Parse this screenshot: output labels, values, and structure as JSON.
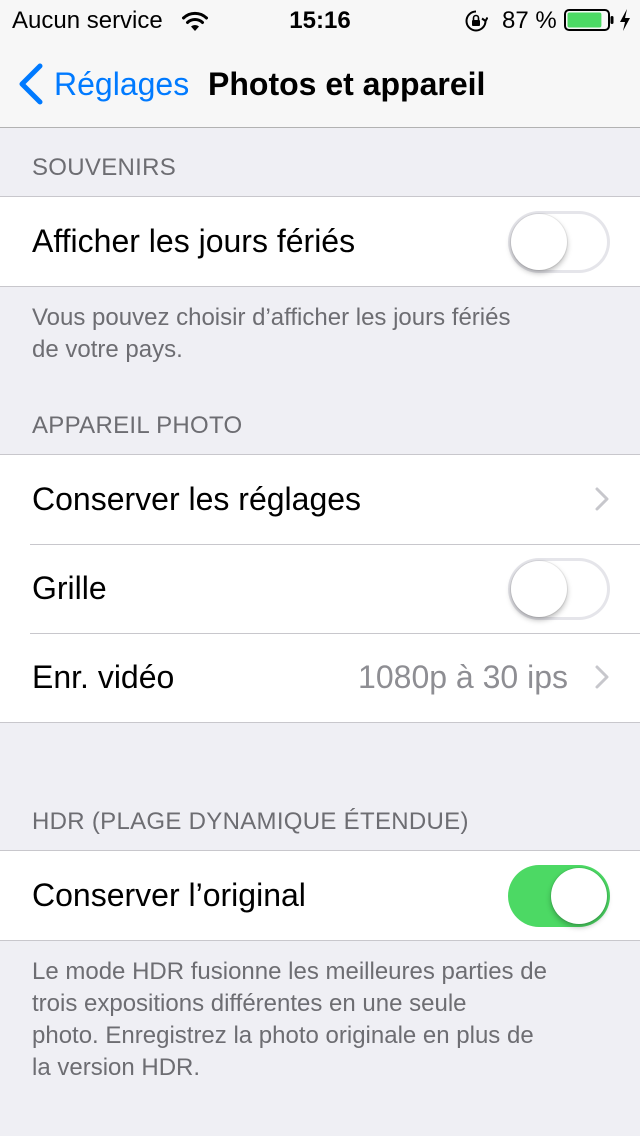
{
  "status_bar": {
    "carrier": "Aucun service",
    "time": "15:16",
    "battery_percent": "87 %",
    "battery_level": 0.87,
    "battery_color": "#4cd964"
  },
  "nav": {
    "back_label": "Réglages",
    "title": "Photos et appareil",
    "accent_color": "#007aff"
  },
  "sections": {
    "souvenirs": {
      "header": "SOUVENIRS",
      "rows": [
        {
          "label": "Afficher les jours fériés",
          "toggle": false
        }
      ],
      "footer": [
        "Vous pouvez choisir d’afficher les jours fériés",
        "de votre pays."
      ]
    },
    "camera": {
      "header": "APPAREIL PHOTO",
      "rows": [
        {
          "label": "Conserver les réglages",
          "chevron": true
        },
        {
          "label": "Grille",
          "toggle": false
        },
        {
          "label": "Enr. vidéo",
          "detail": "1080p à 30 ips",
          "chevron": true
        }
      ]
    },
    "hdr": {
      "header": "HDR (PLAGE DYNAMIQUE ÉTENDUE)",
      "rows": [
        {
          "label": "Conserver l’original",
          "toggle": true
        }
      ],
      "footer": [
        "Le mode HDR fusionne les meilleures parties de",
        "trois expositions différentes en une seule",
        "photo. Enregistrez la photo originale en plus de",
        "la version HDR."
      ]
    }
  },
  "icons": {
    "wifi": "wifi-icon",
    "rotation_lock": "rotation-lock-icon",
    "battery": "battery-icon",
    "charging": "charging-bolt-icon",
    "back": "chevron-left-icon",
    "disclosure": "chevron-right-icon"
  },
  "colors": {
    "background": "#efeff4",
    "switch_on": "#4cd964",
    "secondary_text": "#6d6d72"
  }
}
